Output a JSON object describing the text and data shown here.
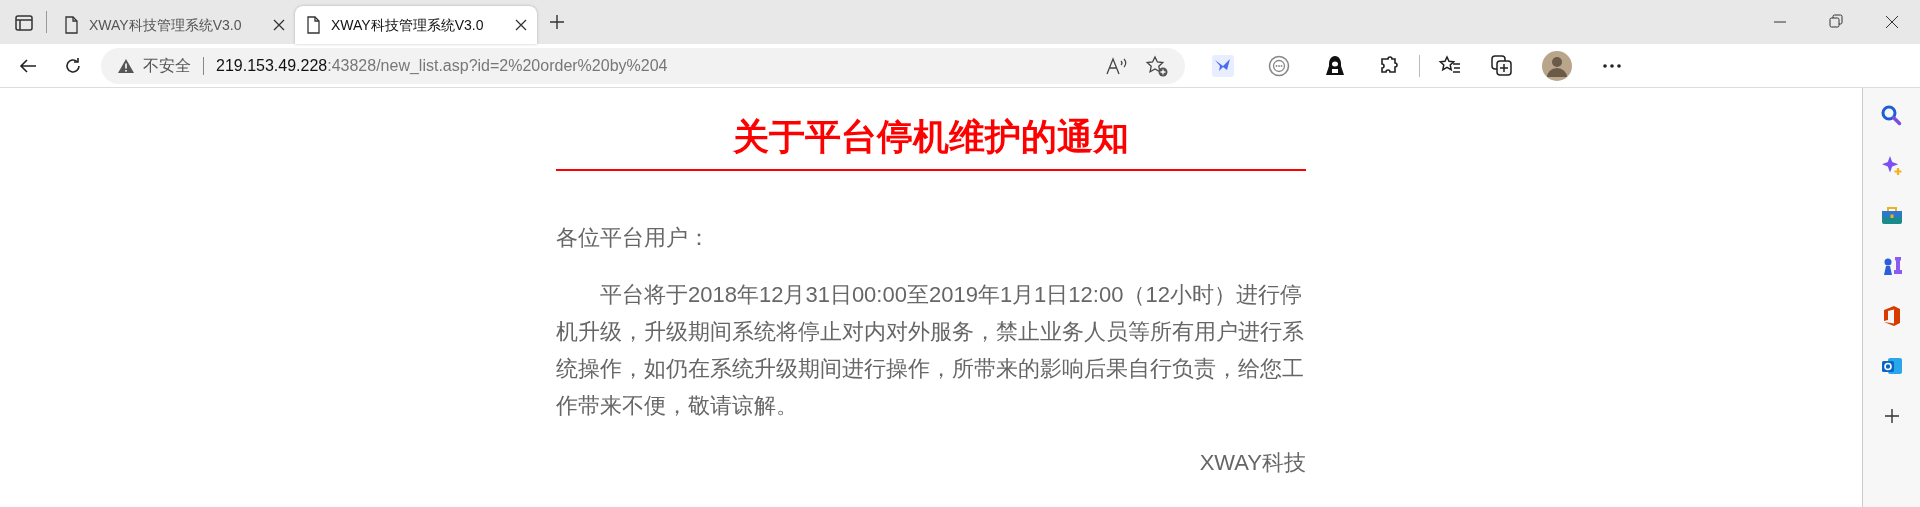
{
  "tabs": [
    {
      "title": "XWAY科技管理系统V3.0",
      "selected": false
    },
    {
      "title": "XWAY科技管理系统V3.0",
      "selected": true
    }
  ],
  "address_bar": {
    "security_label": "不安全",
    "url_host": "219.153.49.228",
    "url_path": ":43828/new_list.asp?id=2%20order%20by%204"
  },
  "article": {
    "title": "关于平台停机维护的通知",
    "greeting": "各位平台用户：",
    "body": "平台将于2018年12月31日00:00至2019年1月1日12:00（12小时）进行停机升级，升级期间系统将停止对内对外服务，禁止业务人员等所有用户进行系统操作，如仍在系统升级期间进行操作，所带来的影响后果自行负责，给您工作带来不便，敬请谅解。",
    "signature": "XWAY科技"
  }
}
